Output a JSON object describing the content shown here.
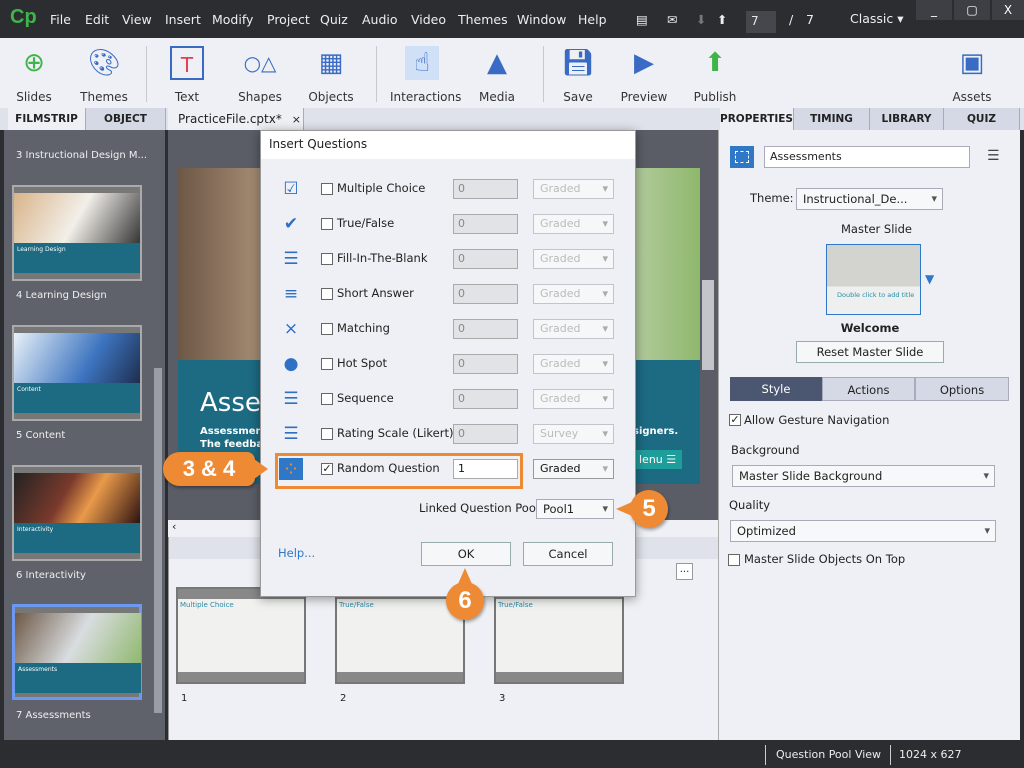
{
  "app": {
    "logo": "Cp",
    "menu": [
      "File",
      "Edit",
      "View",
      "Insert",
      "Modify",
      "Project",
      "Quiz",
      "Audio",
      "Video",
      "Themes",
      "Window",
      "Help"
    ],
    "page_current": "7",
    "page_sep": "/",
    "page_total": "7",
    "workspace": "Classic",
    "win_min": "_",
    "win_max": "▢",
    "win_close": "X"
  },
  "toolbar": [
    {
      "label": "Slides",
      "icon": "plus-circle-icon"
    },
    {
      "label": "Themes",
      "icon": "palette-icon"
    },
    {
      "label": "Text",
      "icon": "text-icon"
    },
    {
      "label": "Shapes",
      "icon": "shapes-icon"
    },
    {
      "label": "Objects",
      "icon": "objects-icon"
    },
    {
      "label": "Interactions",
      "icon": "hand-pointer-icon"
    },
    {
      "label": "Media",
      "icon": "image-icon"
    },
    {
      "label": "Save",
      "icon": "floppy-icon"
    },
    {
      "label": "Preview",
      "icon": "play-icon"
    },
    {
      "label": "Publish",
      "icon": "publish-icon"
    },
    {
      "label": "Assets",
      "icon": "assets-icon"
    }
  ],
  "left_tabs": [
    "FILMSTRIP",
    "OBJECT STATE"
  ],
  "doc_tab": {
    "label": "PracticeFile.cptx*",
    "close": "×"
  },
  "right_tabs": [
    "PROPERTIES",
    "TIMING",
    "LIBRARY",
    "QUIZ"
  ],
  "filmstrip": [
    {
      "label": "3 Instructional Design M..."
    },
    {
      "label": "4 Learning Design",
      "title": "Learning Design"
    },
    {
      "label": "5 Content",
      "title": "Content"
    },
    {
      "label": "6 Interactivity",
      "title": "Interactivity"
    },
    {
      "label": "7 Assessments",
      "title": "Assessments",
      "selected": true
    }
  ],
  "stage": {
    "title": "Asses",
    "line1": "Assessments",
    "line2": "The feedback",
    "side": "signers.",
    "menu": "lenu ☰"
  },
  "pool": {
    "thumbs": [
      {
        "num": "1",
        "title": "Multiple Choice"
      },
      {
        "num": "2",
        "title": "True/False"
      },
      {
        "num": "3",
        "title": "True/False"
      }
    ],
    "more": "..."
  },
  "dialog": {
    "title": "Insert Questions",
    "rows": [
      {
        "label": "Multiple Choice",
        "icon": "multiple-choice-icon",
        "count": "0",
        "grade": "Graded",
        "checked": false
      },
      {
        "label": "True/False",
        "icon": "true-false-icon",
        "count": "0",
        "grade": "Graded",
        "checked": false
      },
      {
        "label": "Fill-In-The-Blank",
        "icon": "fill-blank-icon",
        "count": "0",
        "grade": "Graded",
        "checked": false
      },
      {
        "label": "Short Answer",
        "icon": "short-answer-icon",
        "count": "0",
        "grade": "Graded",
        "checked": false
      },
      {
        "label": "Matching",
        "icon": "matching-icon",
        "count": "0",
        "grade": "Graded",
        "checked": false
      },
      {
        "label": "Hot Spot",
        "icon": "hot-spot-icon",
        "count": "0",
        "grade": "Graded",
        "checked": false
      },
      {
        "label": "Sequence",
        "icon": "sequence-icon",
        "count": "0",
        "grade": "Graded",
        "checked": false
      },
      {
        "label": "Rating Scale (Likert)",
        "icon": "likert-icon",
        "count": "0",
        "grade": "Survey",
        "checked": false
      },
      {
        "label": "Random Question",
        "icon": "random-question-icon",
        "count": "1",
        "grade": "Graded",
        "checked": true
      }
    ],
    "pool_label": "Linked Question Pool:",
    "pool_value": "Pool1",
    "help": "Help...",
    "ok": "OK",
    "cancel": "Cancel"
  },
  "callouts": {
    "a": "3 & 4",
    "b": "5",
    "c": "6"
  },
  "properties": {
    "name": "Assessments",
    "theme_label": "Theme:",
    "theme_value": "Instructional_De...",
    "master_label": "Master Slide",
    "master_thumb_text": "Double click to add title",
    "master_name": "Welcome",
    "reset": "Reset Master Slide",
    "subtabs": [
      "Style",
      "Actions",
      "Options"
    ],
    "gesture": "Allow Gesture Navigation",
    "bg_label": "Background",
    "bg_value": "Master Slide Background",
    "quality_label": "Quality",
    "quality_value": "Optimized",
    "objects_on_top": "Master Slide Objects On Top"
  },
  "status": {
    "view": "Question Pool View",
    "size": "1024 x 627"
  },
  "colors": {
    "accent": "#ee8a33",
    "teal": "#1c6b83",
    "selection": "#6d98f0"
  }
}
